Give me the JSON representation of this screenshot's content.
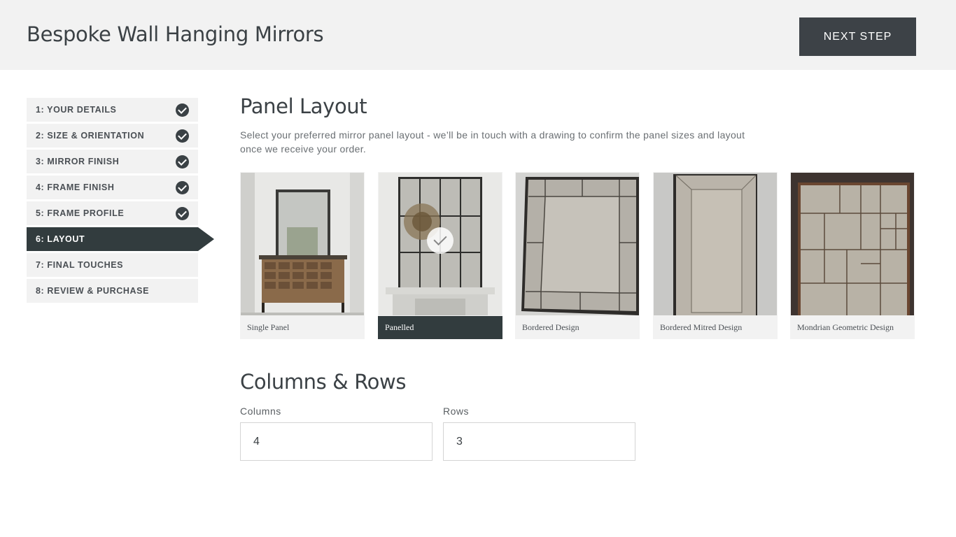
{
  "header": {
    "title": "Bespoke Wall Hanging Mirrors",
    "next_label": "NEXT STEP"
  },
  "steps": [
    {
      "label": "1: YOUR DETAILS",
      "completed": true
    },
    {
      "label": "2: SIZE & ORIENTATION",
      "completed": true
    },
    {
      "label": "3: MIRROR FINISH",
      "completed": true
    },
    {
      "label": "4: FRAME FINISH",
      "completed": true
    },
    {
      "label": "5: FRAME PROFILE",
      "completed": true
    },
    {
      "label": "6: LAYOUT",
      "completed": false,
      "active": true
    },
    {
      "label": "7: FINAL TOUCHES",
      "completed": false
    },
    {
      "label": "8: REVIEW & PURCHASE",
      "completed": false
    }
  ],
  "panel_layout": {
    "title": "Panel Layout",
    "description": "Select your preferred mirror panel layout - we’ll be in touch with a drawing to confirm the panel sizes and layout once we receive your order.",
    "options": [
      {
        "label": "Single Panel",
        "selected": false
      },
      {
        "label": "Panelled",
        "selected": true
      },
      {
        "label": "Bordered Design",
        "selected": false
      },
      {
        "label": "Bordered Mitred Design",
        "selected": false
      },
      {
        "label": "Mondrian Geometric Design",
        "selected": false
      }
    ]
  },
  "columns_rows": {
    "title": "Columns & Rows",
    "columns_label": "Columns",
    "columns_value": "4",
    "rows_label": "Rows",
    "rows_value": "3"
  },
  "colors": {
    "dark": "#323c3e",
    "panel_bg": "#f2f2f2",
    "button": "#3d4247"
  }
}
